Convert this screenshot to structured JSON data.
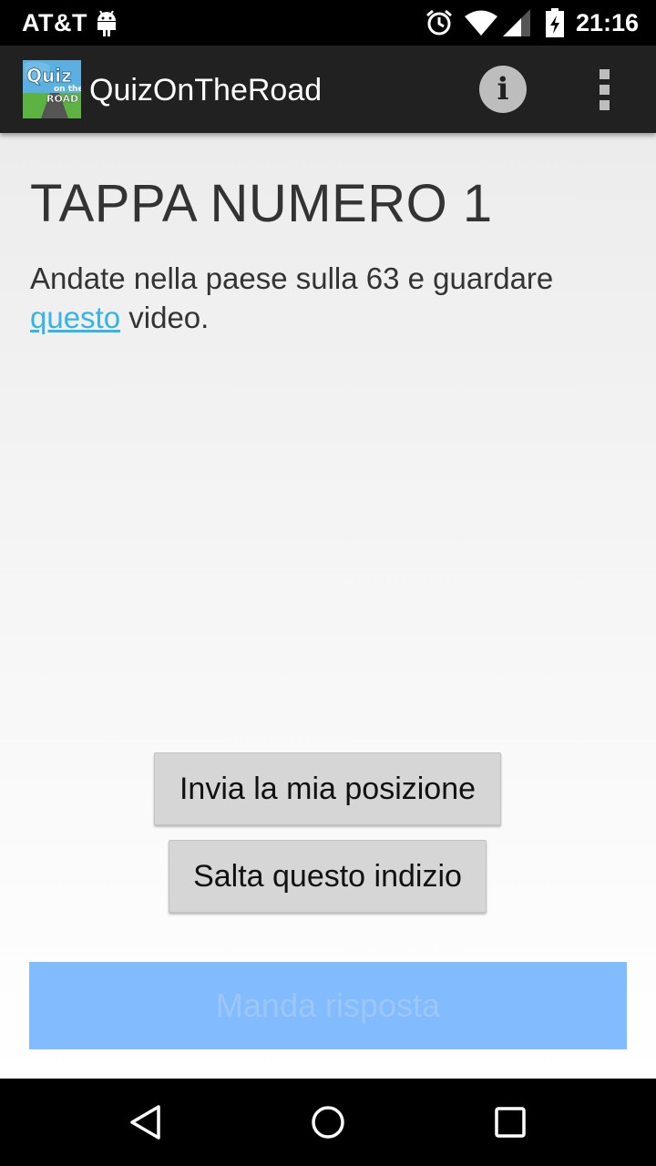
{
  "status_bar": {
    "carrier": "AT&T",
    "time": "21:16"
  },
  "action_bar": {
    "title": "QuizOnTheRoad",
    "logo_text": {
      "line1": "Quiz",
      "line2": "on the",
      "line3": "ROAD"
    }
  },
  "content": {
    "heading": "TAPPA NUMERO 1",
    "text_before_link": "Andate nella paese sulla 63 e guardare ",
    "link_text": "questo",
    "text_after_link": " video.",
    "buttons": {
      "send_location": "Invia la mia posizione",
      "skip_hint": "Salta questo indizio",
      "submit_answer": "Manda risposta"
    }
  },
  "colors": {
    "action_bar": "#212121",
    "link": "#33b5e5",
    "submit_button": "#82bcff"
  },
  "icons": [
    "android-icon",
    "alarm-icon",
    "wifi-icon",
    "signal-icon",
    "battery-icon",
    "info-icon",
    "overflow-menu-icon",
    "back-icon",
    "home-icon",
    "recents-icon"
  ]
}
